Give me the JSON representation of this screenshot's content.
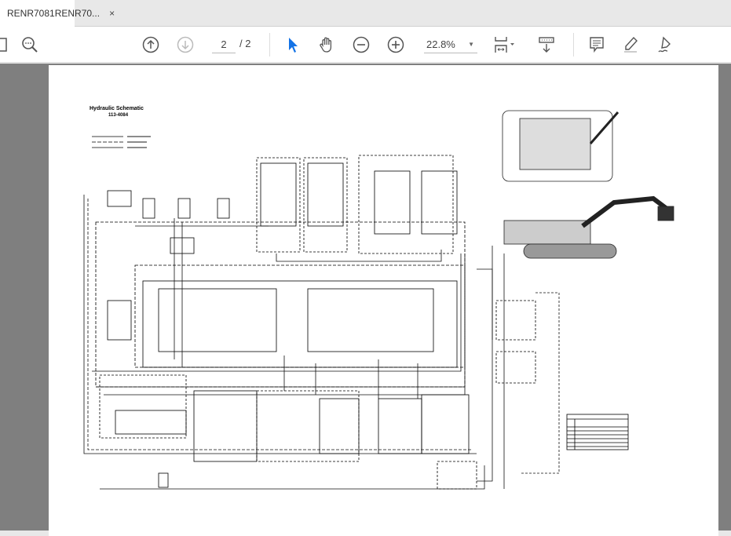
{
  "tab": {
    "title": "RENR7081RENR70...",
    "close": "×"
  },
  "toolbar": {
    "current_page": "2",
    "total_pages": "/ 2",
    "zoom": "22.8%"
  },
  "document": {
    "title": "Hydraulic Schematic",
    "number": "113-4084"
  },
  "colors": {
    "viewer_bg": "#7f7f7f",
    "select_tool": "#1473e6"
  }
}
